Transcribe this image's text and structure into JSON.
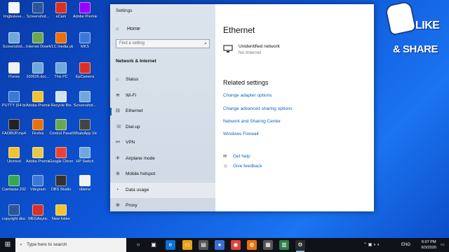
{
  "desktop": {
    "icons": [
      {
        "label": "Imgbuleee...",
        "color": "#f5f5f5"
      },
      {
        "label": "Screenshot...",
        "color": "#6fa8dc"
      },
      {
        "label": "iTunes",
        "color": "#f0f0f0"
      },
      {
        "label": "PUTTY (64-bit)",
        "color": "#3c78d8"
      },
      {
        "label": "FAOBUP.mp4",
        "color": "#222222"
      },
      {
        "label": "Utorrent",
        "color": "#f1c232"
      },
      {
        "label": "Camtasia 2020",
        "color": "#34a853"
      },
      {
        "label": "copyright disclaimer...",
        "color": "#2b579a"
      },
      {
        "label": "Screenshot...",
        "color": "#2b579a"
      },
      {
        "label": "Internet Downlo...",
        "color": "#6aa84f"
      },
      {
        "label": "100626.doc...",
        "color": "#6fa8dc"
      },
      {
        "label": "Adobe Premiere P...",
        "color": "#f1c232"
      },
      {
        "label": "Firefox",
        "color": "#e8710a"
      },
      {
        "label": "Adobe Premiere P...",
        "color": "#e6c84a"
      },
      {
        "label": "Vdegram",
        "color": "#3c78d8"
      },
      {
        "label": "MEGAsync",
        "color": "#d93025"
      },
      {
        "label": "eCam",
        "color": "#d93025"
      },
      {
        "label": "VLC media player",
        "color": "#e8710a"
      },
      {
        "label": "This PC",
        "color": "#6fa8dc"
      },
      {
        "label": "Recycle Bin",
        "color": "#cfe2f3"
      },
      {
        "label": "Control Panel",
        "color": "#6aa84f"
      },
      {
        "label": "Google Chrome",
        "color": "#ea4335"
      },
      {
        "label": "OBS Studio",
        "color": "#333333"
      },
      {
        "label": "New folder",
        "color": "#f1c232"
      },
      {
        "label": "Adobe Premiere P...",
        "color": "#9900ff"
      },
      {
        "label": "MKS",
        "color": "#3c78d8"
      },
      {
        "label": "EpCamera",
        "color": "#d93025"
      },
      {
        "label": "Screenshot...",
        "color": "#6fa8dc"
      },
      {
        "label": "WhatsApp Video 2020...",
        "color": "#444444"
      },
      {
        "label": "HP Switch",
        "color": "#6fa8dc"
      },
      {
        "label": "obiene",
        "color": "#f3f3f3"
      }
    ]
  },
  "window": {
    "title": "Settings",
    "controls": {
      "minimize": "—",
      "maximize": "☐",
      "close": "✕"
    },
    "sidebar": {
      "home": "Home",
      "search_placeholder": "Find a setting",
      "section": "Network & Internet",
      "items": [
        {
          "label": "Status",
          "icon": "status-icon",
          "glyph": "⌂"
        },
        {
          "label": "Wi-Fi",
          "icon": "wifi-icon",
          "glyph": "≋"
        },
        {
          "label": "Ethernet",
          "icon": "ethernet-icon",
          "glyph": "⊟"
        },
        {
          "label": "Dial-up",
          "icon": "dialup-icon",
          "glyph": "☏"
        },
        {
          "label": "VPN",
          "icon": "vpn-icon",
          "glyph": "⚯"
        },
        {
          "label": "Airplane mode",
          "icon": "airplane-icon",
          "glyph": "✈"
        },
        {
          "label": "Mobile hotspot",
          "icon": "hotspot-icon",
          "glyph": "((•))"
        },
        {
          "label": "Data usage",
          "icon": "data-usage-icon",
          "glyph": "◔"
        },
        {
          "label": "Proxy",
          "icon": "proxy-icon",
          "glyph": "⊕"
        }
      ]
    },
    "main": {
      "title": "Ethernet",
      "network_name": "Unidentified network",
      "network_status": "No Internet",
      "related_heading": "Related settings",
      "links": [
        "Change adapter options",
        "Change advanced sharing options",
        "Network and Sharing Center",
        "Windows Firewall"
      ],
      "help": [
        {
          "label": "Get help",
          "icon": "help-icon",
          "glyph": "💬"
        },
        {
          "label": "Give feedback",
          "icon": "feedback-icon",
          "glyph": "👤"
        }
      ]
    }
  },
  "taskbar": {
    "search_text": "Type here to search",
    "tray_lang": "ENG",
    "time": "6:07 PM",
    "date": "6/3/2020"
  },
  "promo": {
    "like": "LIKE",
    "share": "& SHARE"
  },
  "colors": {
    "accent": "#0063b1",
    "link": "#0a66c2",
    "desktop": "#0d56d8"
  }
}
